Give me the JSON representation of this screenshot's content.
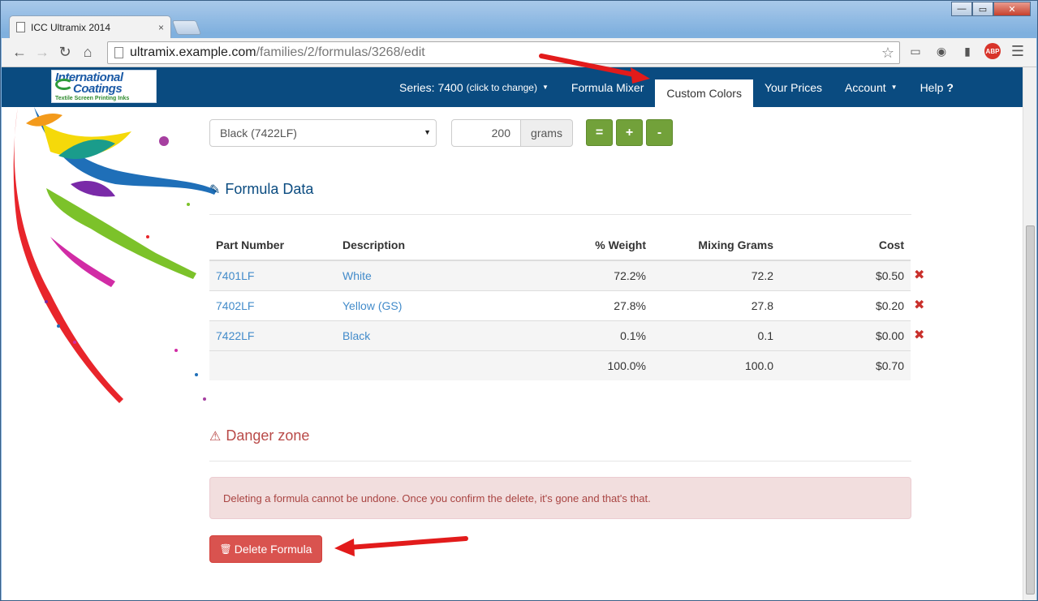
{
  "browser": {
    "tab_title": "ICC Ultramix 2014",
    "tab_close": "×",
    "url_host": "ultramix.example.com",
    "url_path": "/families/2/formulas/3268/edit",
    "abp_label": "ABP",
    "window_controls": {
      "minimize": "—",
      "maximize": "▭",
      "close": "✕"
    }
  },
  "logo": {
    "line1": "International",
    "line2": "Coatings",
    "tagline": "Textile Screen Printing Inks"
  },
  "nav": {
    "series_label": "Series: 7400",
    "series_hint": "(click to change)",
    "formula_mixer": "Formula Mixer",
    "custom_colors": "Custom Colors",
    "your_prices": "Your Prices",
    "account": "Account",
    "help": "Help",
    "help_icon": "?"
  },
  "mixer": {
    "selected_color": "Black (7422LF)",
    "grams_value": "200",
    "grams_unit": "grams",
    "buttons": {
      "equals": "=",
      "plus": "+",
      "minus": "-"
    }
  },
  "formula_data": {
    "heading": "Formula Data",
    "columns": {
      "part": "Part Number",
      "description": "Description",
      "weight": "% Weight",
      "grams": "Mixing Grams",
      "cost": "Cost"
    },
    "rows": [
      {
        "part": "7401LF",
        "description": "White",
        "weight": "72.2%",
        "grams": "72.2",
        "cost": "$0.50"
      },
      {
        "part": "7402LF",
        "description": "Yellow (GS)",
        "weight": "27.8%",
        "grams": "27.8",
        "cost": "$0.20"
      },
      {
        "part": "7422LF",
        "description": "Black",
        "weight": "0.1%",
        "grams": "0.1",
        "cost": "$0.00"
      }
    ],
    "totals": {
      "weight": "100.0%",
      "grams": "100.0",
      "cost": "$0.70"
    }
  },
  "danger": {
    "heading": "Danger zone",
    "warning": "Deleting a formula cannot be undone. Once you confirm the delete, it's gone and that's that.",
    "delete_button": "Delete Formula"
  }
}
